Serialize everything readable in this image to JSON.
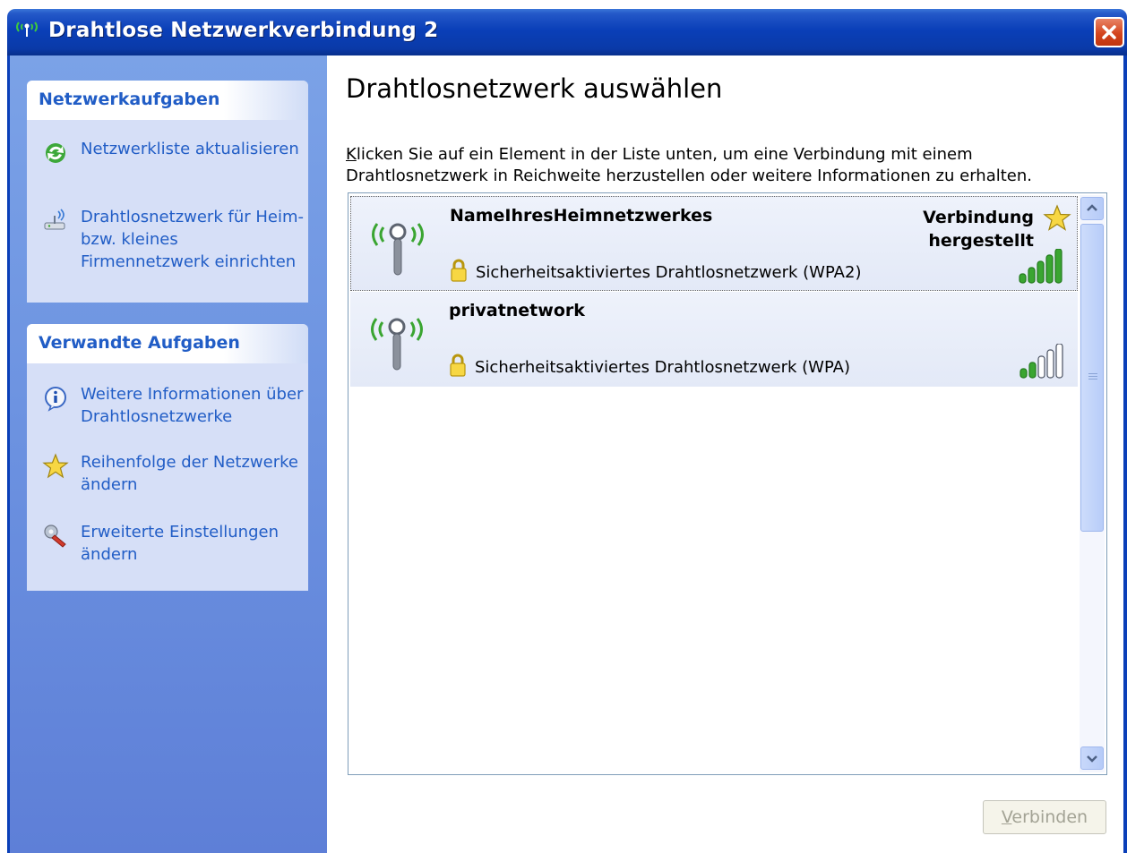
{
  "window": {
    "title": "Drahtlose Netzwerkverbindung 2",
    "close_icon": "close-icon"
  },
  "sidebar": {
    "network_tasks": {
      "heading": "Netzwerkaufgaben",
      "items": [
        {
          "label": "Netzwerkliste aktualisieren",
          "icon": "refresh-icon"
        },
        {
          "label": "Drahtlosnetzwerk für Heim- bzw. kleines Firmennetzwerk einrichten",
          "icon": "wireless-setup-icon"
        }
      ]
    },
    "related_tasks": {
      "heading": "Verwandte Aufgaben",
      "items": [
        {
          "label": "Weitere Informationen über Drahtlosnetzwerke",
          "icon": "info-icon"
        },
        {
          "label": "Reihenfolge der Netzwerke ändern",
          "icon": "star-icon"
        },
        {
          "label": "Erweiterte Einstellungen ändern",
          "icon": "settings-icon"
        }
      ]
    }
  },
  "main": {
    "title": "Drahtlosnetzwerk auswählen",
    "description_accel": "K",
    "description_rest": "licken Sie auf ein Element in der Liste unten, um eine Verbindung mit einem Drahtlosnetzwerk in Reichweite herzustellen oder weitere Informationen zu erhalten.",
    "networks": [
      {
        "name": "NameIhresHeimnetzwerkes",
        "security": "Sicherheitsaktiviertes Drahtlosnetzwerk (WPA2)",
        "status": "Verbindung hergestellt",
        "signal_bars": 5,
        "selected": true
      },
      {
        "name": "privatnetwork",
        "security": "Sicherheitsaktiviertes Drahtlosnetzwerk (WPA)",
        "status": "",
        "signal_bars": 2,
        "selected": false
      }
    ],
    "connect_button": {
      "accel": "V",
      "rest": "erbinden",
      "enabled": false
    }
  },
  "colors": {
    "titlebar": "#0a3fb8",
    "sidebar": "#6b91e0",
    "task_link": "#215dc6",
    "list_row": "#e8edf9",
    "signal_on": "#3aa531"
  }
}
